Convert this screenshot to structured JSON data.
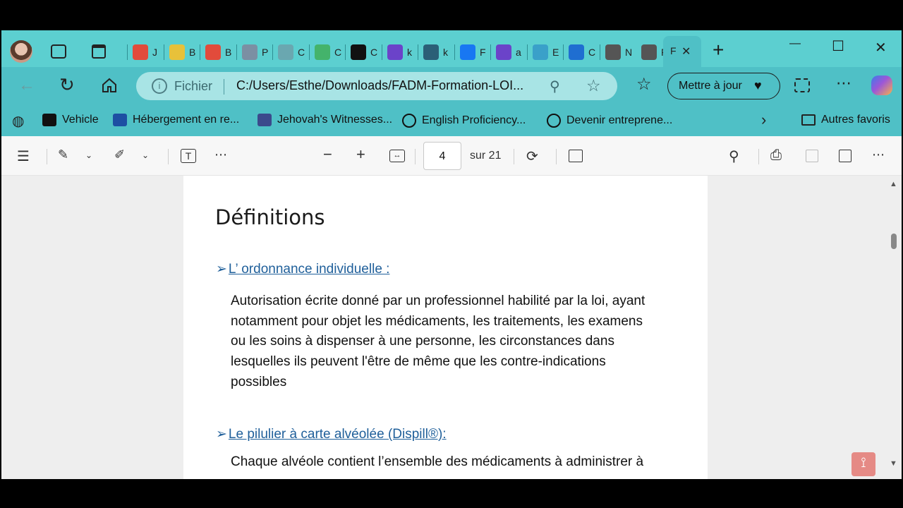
{
  "tabs": [
    {
      "letter": "J",
      "icon": "gmail-icon",
      "color": "#e24b3b"
    },
    {
      "letter": "B",
      "icon": "100plus-icon",
      "color": "#e8c13a"
    },
    {
      "letter": "B",
      "icon": "gmail-icon",
      "color": "#e24b3b"
    },
    {
      "letter": "P",
      "icon": "hexagon-icon",
      "color": "#7b8fa3"
    },
    {
      "letter": "C",
      "icon": "globe-icon",
      "color": "#6aa7b0"
    },
    {
      "letter": "C",
      "icon": "green-leaf-icon",
      "color": "#44b36b"
    },
    {
      "letter": "C",
      "icon": "chatgpt-icon",
      "color": "#111111"
    },
    {
      "letter": "k",
      "icon": "yahoo-icon",
      "color": "#6b43c9"
    },
    {
      "letter": "k",
      "icon": "k-icon",
      "color": "#2b5f77"
    },
    {
      "letter": "F",
      "icon": "facebook-icon",
      "color": "#1877f2"
    },
    {
      "letter": "a",
      "icon": "yahoo-icon",
      "color": "#6b43c9"
    },
    {
      "letter": "E",
      "icon": "copilot-icon",
      "color": "#3aa0c9"
    },
    {
      "letter": "C",
      "icon": "outlook-icon",
      "color": "#1f6ed1"
    },
    {
      "letter": "N",
      "icon": "grid-icon",
      "color": "#555555"
    },
    {
      "letter": "F",
      "icon": "pdf-icon",
      "color": "#555555"
    }
  ],
  "active_tab": {
    "letter": "F",
    "close": "✕"
  },
  "new_tab": "+",
  "window_controls": {
    "minimize": "—",
    "maximize": "☐",
    "close": "✕"
  },
  "address": {
    "scheme_label": "Fichier",
    "url": "C:/Users/Esthe/Downloads/FADM-Formation-LOI..."
  },
  "update_button": "Mettre à jour",
  "bookmarks": [
    {
      "label": "Vehicle",
      "icon": "vehicle-icon",
      "color": "#111111"
    },
    {
      "label": "Hébergement en re...",
      "icon": "quebec-flag-icon",
      "color": "#1d4fa3"
    },
    {
      "label": "Jehovah's Witnesses...",
      "icon": "jw-icon",
      "color": "#3b4a8c"
    },
    {
      "label": "English Proficiency...",
      "icon": "globe-icon",
      "color": "#111111"
    },
    {
      "label": "Devenir entreprene...",
      "icon": "globe-icon",
      "color": "#111111"
    }
  ],
  "other_favorites": "Autres favoris",
  "pdf_toolbar": {
    "page_current": "4",
    "page_total": "sur 21"
  },
  "document": {
    "heading": "Définitions",
    "section1_title": "L’ ordonnance individuelle :",
    "section1_lines": [
      "Autorisation écrite donné par un professionnel habilité par la loi, ayant",
      "notamment pour objet les médicaments, les traitements, les examens",
      "ou les soins à dispenser à une personne, les circonstances dans",
      "lesquelles ils peuvent l'être de même que les contre-indications",
      "possibles"
    ],
    "section2_title": "Le pilulier à carte alvéolée (Dispill®):",
    "section2_line": "Chaque alvéole contient l’ensemble des médicaments à administrer à"
  },
  "colors": {
    "frame": "#5ccfd0",
    "toolbar": "#4fc0c6",
    "link": "#1f5f9a"
  }
}
